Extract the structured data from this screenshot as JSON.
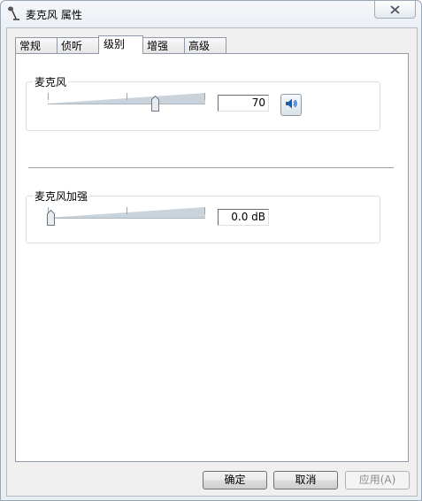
{
  "window": {
    "title": "麦克风 属性"
  },
  "tabs": [
    {
      "label": "常规",
      "active": false
    },
    {
      "label": "侦听",
      "active": false
    },
    {
      "label": "级别",
      "active": true
    },
    {
      "label": "增强",
      "active": false
    },
    {
      "label": "高级",
      "active": false
    }
  ],
  "levels": {
    "microphone": {
      "label": "麦克风",
      "value": "70",
      "level": 70,
      "muted": false
    },
    "boost": {
      "label": "麦克风加强",
      "value": "0.0 dB",
      "level": 0
    }
  },
  "buttons": {
    "ok": "确定",
    "cancel": "取消",
    "apply": "应用(A)"
  },
  "icons": {
    "title": "microphone-icon",
    "close": "close-icon",
    "mute": "speaker-icon"
  },
  "colors": {
    "speaker_blue": "#1a5fb4",
    "slider_track": "#c8d3dc"
  }
}
